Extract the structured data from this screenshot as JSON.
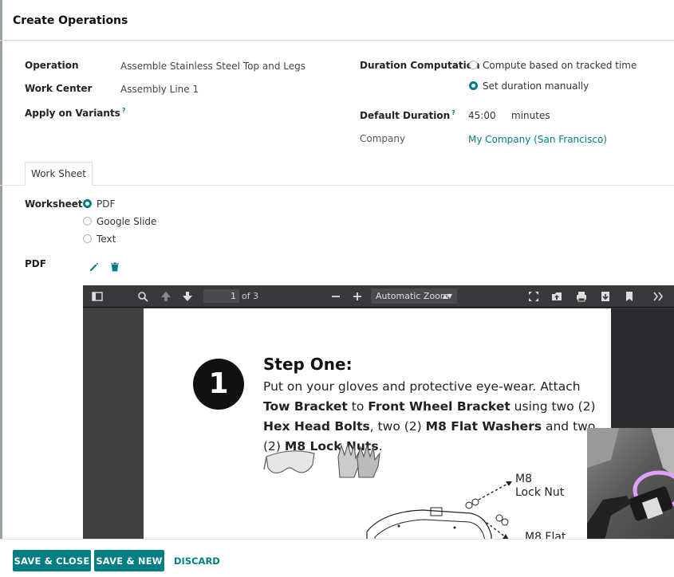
{
  "dialog": {
    "title": "Create Operations"
  },
  "form": {
    "operation_label": "Operation",
    "operation_value": "Assemble Stainless Steel Top and Legs",
    "work_center_label": "Work Center",
    "work_center_value": "Assembly Line 1",
    "apply_variants_label": "Apply on Variants",
    "help_mark": "?",
    "duration_computation_label": "Duration Computation",
    "duration_options": [
      {
        "label": "Compute based on tracked time",
        "selected": false
      },
      {
        "label": "Set duration manually",
        "selected": true
      }
    ],
    "default_duration_label": "Default Duration",
    "default_duration_value": "45:00",
    "default_duration_unit": "minutes",
    "company_label": "Company",
    "company_value": "My Company (San Francisco)"
  },
  "tabs": [
    {
      "label": "Work Sheet",
      "active": true
    }
  ],
  "worksheet": {
    "label": "Worksheet",
    "options": [
      {
        "label": "PDF",
        "selected": true
      },
      {
        "label": "Google Slide",
        "selected": false
      },
      {
        "label": "Text",
        "selected": false
      }
    ],
    "pdf_label": "PDF"
  },
  "pdf_viewer": {
    "page_current": "1",
    "page_total": "of 3",
    "zoom": "Automatic Zoom",
    "document": {
      "step_number": "1",
      "step_title": "Step One:",
      "body_parts": [
        {
          "text": "Put on your gloves and protective eye-wear. Attach ",
          "bold": false
        },
        {
          "text": "Tow Bracket",
          "bold": true
        },
        {
          "text": " to ",
          "bold": false
        },
        {
          "text": "Front Wheel Bracket",
          "bold": true
        },
        {
          "text": " using two (2) ",
          "bold": false
        },
        {
          "text": "Hex Head Bolts",
          "bold": true
        },
        {
          "text": ", two (2) ",
          "bold": false
        },
        {
          "text": "M8 Flat Washers",
          "bold": true
        },
        {
          "text": " and two (2) ",
          "bold": false
        },
        {
          "text": "M8 Lock Nuts",
          "bold": true
        },
        {
          "text": ".",
          "bold": false
        }
      ],
      "callout_lock_nut": "M8\nLock Nut",
      "callout_flat": "M8 Flat"
    }
  },
  "footer": {
    "save_close": "SAVE & CLOSE",
    "save_new": "SAVE & NEW",
    "discard": "DISCARD"
  },
  "colors": {
    "accent": "#017e84",
    "viewer_toolbar": "#38383d",
    "viewer_bg": "#404040"
  }
}
